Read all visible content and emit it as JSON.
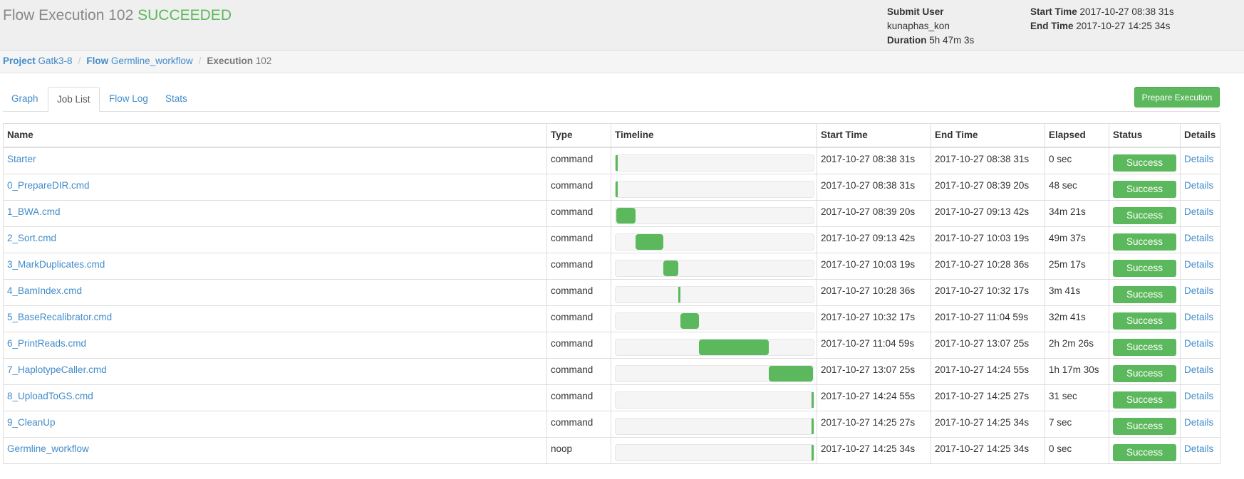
{
  "header": {
    "title": "Flow Execution 102",
    "status": "SUCCEEDED",
    "submit_user_label": "Submit User",
    "submit_user": "kunaphas_kon",
    "duration_label": "Duration",
    "duration": "5h 47m 3s",
    "start_time_label": "Start Time",
    "start_time": "2017-10-27 08:38 31s",
    "end_time_label": "End Time",
    "end_time": "2017-10-27 14:25 34s"
  },
  "breadcrumb": {
    "project_label": "Project",
    "project": "Gatk3-8",
    "flow_label": "Flow",
    "flow": "Germline_workflow",
    "execution_label": "Execution",
    "execution": "102"
  },
  "tabs": [
    "Graph",
    "Job List",
    "Flow Log",
    "Stats"
  ],
  "active_tab": "Job List",
  "prepare_button": "Prepare Execution",
  "columns": [
    "Name",
    "Type",
    "Timeline",
    "Start Time",
    "End Time",
    "Elapsed",
    "Status",
    "Details"
  ],
  "colors": {
    "success": "#5cb85c",
    "link": "#428bca"
  },
  "jobs": [
    {
      "name": "Starter",
      "type": "command",
      "start": "2017-10-27 08:38 31s",
      "end": "2017-10-27 08:38 31s",
      "elapsed": "0 sec",
      "status": "Success",
      "details": "Details",
      "tl_start": 0.0,
      "tl_end": 0.0
    },
    {
      "name": "0_PrepareDIR.cmd",
      "type": "command",
      "start": "2017-10-27 08:38 31s",
      "end": "2017-10-27 08:39 20s",
      "elapsed": "48 sec",
      "status": "Success",
      "details": "Details",
      "tl_start": 0.0,
      "tl_end": 0.0023
    },
    {
      "name": "1_BWA.cmd",
      "type": "command",
      "start": "2017-10-27 08:39 20s",
      "end": "2017-10-27 09:13 42s",
      "elapsed": "34m 21s",
      "status": "Success",
      "details": "Details",
      "tl_start": 0.0024,
      "tl_end": 0.0994
    },
    {
      "name": "2_Sort.cmd",
      "type": "command",
      "start": "2017-10-27 09:13 42s",
      "end": "2017-10-27 10:03 19s",
      "elapsed": "49m 37s",
      "status": "Success",
      "details": "Details",
      "tl_start": 0.0994,
      "tl_end": 0.2424
    },
    {
      "name": "3_MarkDuplicates.cmd",
      "type": "command",
      "start": "2017-10-27 10:03 19s",
      "end": "2017-10-27 10:28 36s",
      "elapsed": "25m 17s",
      "status": "Success",
      "details": "Details",
      "tl_start": 0.2424,
      "tl_end": 0.3153
    },
    {
      "name": "4_BamIndex.cmd",
      "type": "command",
      "start": "2017-10-27 10:28 36s",
      "end": "2017-10-27 10:32 17s",
      "elapsed": "3m 41s",
      "status": "Success",
      "details": "Details",
      "tl_start": 0.3153,
      "tl_end": 0.3259
    },
    {
      "name": "5_BaseRecalibrator.cmd",
      "type": "command",
      "start": "2017-10-27 10:32 17s",
      "end": "2017-10-27 11:04 59s",
      "elapsed": "32m 41s",
      "status": "Success",
      "details": "Details",
      "tl_start": 0.3259,
      "tl_end": 0.4201
    },
    {
      "name": "6_PrintReads.cmd",
      "type": "command",
      "start": "2017-10-27 11:04 59s",
      "end": "2017-10-27 13:07 25s",
      "elapsed": "2h 2m 26s",
      "status": "Success",
      "details": "Details",
      "tl_start": 0.4201,
      "tl_end": 0.773
    },
    {
      "name": "7_HaplotypeCaller.cmd",
      "type": "command",
      "start": "2017-10-27 13:07 25s",
      "end": "2017-10-27 14:24 55s",
      "elapsed": "1h 17m 30s",
      "status": "Success",
      "details": "Details",
      "tl_start": 0.773,
      "tl_end": 0.9964
    },
    {
      "name": "8_UploadToGS.cmd",
      "type": "command",
      "start": "2017-10-27 14:24 55s",
      "end": "2017-10-27 14:25 27s",
      "elapsed": "31 sec",
      "status": "Success",
      "details": "Details",
      "tl_start": 0.9964,
      "tl_end": 0.998
    },
    {
      "name": "9_CleanUp",
      "type": "command",
      "start": "2017-10-27 14:25 27s",
      "end": "2017-10-27 14:25 34s",
      "elapsed": "7 sec",
      "status": "Success",
      "details": "Details",
      "tl_start": 0.998,
      "tl_end": 1.0
    },
    {
      "name": "Germline_workflow",
      "type": "noop",
      "start": "2017-10-27 14:25 34s",
      "end": "2017-10-27 14:25 34s",
      "elapsed": "0 sec",
      "status": "Success",
      "details": "Details",
      "tl_start": 1.0,
      "tl_end": 1.0
    }
  ]
}
